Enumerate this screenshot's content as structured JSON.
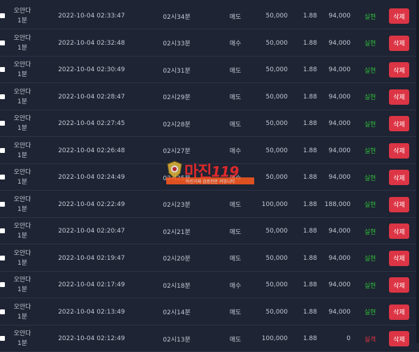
{
  "colors": {
    "background": "#1e2433",
    "delete_button": "#dc3545",
    "result_hit": "#2fbf3a",
    "result_miss": "#e53645"
  },
  "watermark": {
    "brand": "마진",
    "suffix": "119",
    "tagline": "마진거래 검증전문 커뮤니티"
  },
  "rows": [
    {
      "game_line1": "오안다",
      "game_line2": "1분",
      "time": "2022-10-04 02:33:47",
      "round": "02시34분",
      "type": "매도",
      "amount": "50,000",
      "odds": "1.88",
      "payout": "94,000",
      "result": "실현",
      "result_kind": "hit",
      "delete": "삭제"
    },
    {
      "game_line1": "오안다",
      "game_line2": "1분",
      "time": "2022-10-04 02:32:48",
      "round": "02시33분",
      "type": "매수",
      "amount": "50,000",
      "odds": "1.88",
      "payout": "94,000",
      "result": "실현",
      "result_kind": "hit",
      "delete": "삭제"
    },
    {
      "game_line1": "오안다",
      "game_line2": "1분",
      "time": "2022-10-04 02:30:49",
      "round": "02시31분",
      "type": "매도",
      "amount": "50,000",
      "odds": "1.88",
      "payout": "94,000",
      "result": "실현",
      "result_kind": "hit",
      "delete": "삭제"
    },
    {
      "game_line1": "오안다",
      "game_line2": "1분",
      "time": "2022-10-04 02:28:47",
      "round": "02시29분",
      "type": "매도",
      "amount": "50,000",
      "odds": "1.88",
      "payout": "94,000",
      "result": "실현",
      "result_kind": "hit",
      "delete": "삭제"
    },
    {
      "game_line1": "오안다",
      "game_line2": "1분",
      "time": "2022-10-04 02:27:45",
      "round": "02시28분",
      "type": "매도",
      "amount": "50,000",
      "odds": "1.88",
      "payout": "94,000",
      "result": "실현",
      "result_kind": "hit",
      "delete": "삭제"
    },
    {
      "game_line1": "오안다",
      "game_line2": "1분",
      "time": "2022-10-04 02:26:48",
      "round": "02시27분",
      "type": "매수",
      "amount": "50,000",
      "odds": "1.88",
      "payout": "94,000",
      "result": "실현",
      "result_kind": "hit",
      "delete": "삭제"
    },
    {
      "game_line1": "오안다",
      "game_line2": "1분",
      "time": "2022-10-04 02:24:49",
      "round": "02시25분",
      "type": "매수",
      "amount": "50,000",
      "odds": "1.88",
      "payout": "94,000",
      "result": "실현",
      "result_kind": "hit",
      "delete": "삭제"
    },
    {
      "game_line1": "오안다",
      "game_line2": "1분",
      "time": "2022-10-04 02:22:49",
      "round": "02시23분",
      "type": "매도",
      "amount": "100,000",
      "odds": "1.88",
      "payout": "188,000",
      "result": "실현",
      "result_kind": "hit",
      "delete": "삭제"
    },
    {
      "game_line1": "오안다",
      "game_line2": "1분",
      "time": "2022-10-04 02:20:47",
      "round": "02시21분",
      "type": "매도",
      "amount": "50,000",
      "odds": "1.88",
      "payout": "94,000",
      "result": "실현",
      "result_kind": "hit",
      "delete": "삭제"
    },
    {
      "game_line1": "오안다",
      "game_line2": "1분",
      "time": "2022-10-04 02:19:47",
      "round": "02시20분",
      "type": "매도",
      "amount": "50,000",
      "odds": "1.88",
      "payout": "94,000",
      "result": "실현",
      "result_kind": "hit",
      "delete": "삭제"
    },
    {
      "game_line1": "오안다",
      "game_line2": "1분",
      "time": "2022-10-04 02:17:49",
      "round": "02시18분",
      "type": "매수",
      "amount": "50,000",
      "odds": "1.88",
      "payout": "94,000",
      "result": "실현",
      "result_kind": "hit",
      "delete": "삭제"
    },
    {
      "game_line1": "오안다",
      "game_line2": "1분",
      "time": "2022-10-04 02:13:49",
      "round": "02시14분",
      "type": "매도",
      "amount": "50,000",
      "odds": "1.88",
      "payout": "94,000",
      "result": "실현",
      "result_kind": "hit",
      "delete": "삭제"
    },
    {
      "game_line1": "오안다",
      "game_line2": "1분",
      "time": "2022-10-04 02:12:49",
      "round": "02시13분",
      "type": "매도",
      "amount": "100,000",
      "odds": "1.88",
      "payout": "0",
      "result": "실격",
      "result_kind": "miss",
      "delete": "삭제"
    }
  ]
}
